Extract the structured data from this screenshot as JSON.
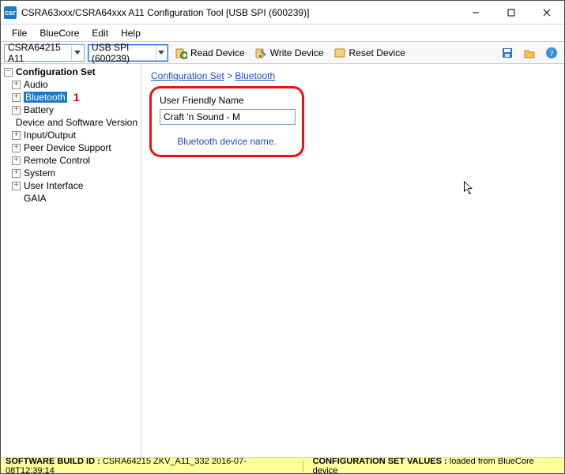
{
  "titlebar": {
    "app_icon_text": "csr",
    "title": "CSRA63xxx/CSRA64xxx A11 Configuration Tool [USB SPI (600239)]"
  },
  "menu": {
    "file": "File",
    "bluecore": "BlueCore",
    "edit": "Edit",
    "help": "Help"
  },
  "toolbar": {
    "device_combo": "CSRA64215 A11",
    "transport_combo": "USB SPI (600239)",
    "read": "Read Device",
    "write": "Write Device",
    "reset": "Reset Device"
  },
  "tree": {
    "root": "Configuration Set",
    "items": [
      "Audio",
      "Bluetooth",
      "Battery",
      "Device and Software Version",
      "Input/Output",
      "Peer Device Support",
      "Remote Control",
      "System",
      "User Interface",
      "GAIA"
    ],
    "annotation": "1"
  },
  "breadcrumb": {
    "root": "Configuration Set",
    "sep": " > ",
    "leaf": "Bluetooth"
  },
  "form": {
    "label": "User Friendly Name",
    "value": "Craft 'n Sound - M",
    "help": "Bluetooth device name."
  },
  "status": {
    "k1": "SOFTWARE BUILD ID :",
    "v1": "CSRA64215 ZKV_A11_332 2016-07-08T12:39:14",
    "k2": "CONFIGURATION SET VALUES :",
    "v2": "loaded from BlueCore device"
  }
}
